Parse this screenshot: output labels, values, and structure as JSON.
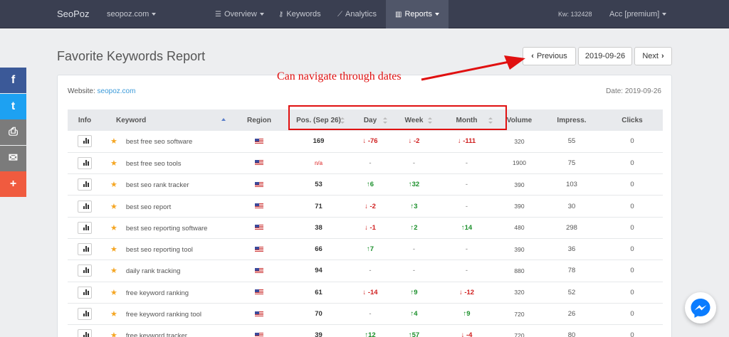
{
  "nav": {
    "brand": "SeoPoz",
    "site": "seopoz.com",
    "overview": "Overview",
    "keywords": "Keywords",
    "analytics": "Analytics",
    "reports": "Reports",
    "kw": "Kw: 132428",
    "acc": "Acc [premium]"
  },
  "page": {
    "title": "Favorite Keywords Report",
    "previous": "Previous",
    "date_btn": "2019-09-26",
    "next": "Next",
    "website_label": "Website:",
    "website": "seopoz.com",
    "date": "Date: 2019-09-26"
  },
  "annotation": {
    "text": "Can navigate through dates",
    "color": "#e01010"
  },
  "table": {
    "headers": [
      "Info",
      "Keyword",
      "Region",
      "Pos. (Sep 26)",
      "Day",
      "Week",
      "Month",
      "Volume",
      "Impress.",
      "Clicks"
    ],
    "rows": [
      {
        "keyword": "best free seo software",
        "pos": "169",
        "day": {
          "t": "-76",
          "d": "down"
        },
        "week": {
          "t": "-2",
          "d": "down"
        },
        "month": {
          "t": "-111",
          "d": "down"
        },
        "volume": "320",
        "impress": "55",
        "clicks": "0"
      },
      {
        "keyword": "best free seo tools",
        "pos": "n/a",
        "day": {
          "t": "-",
          "d": ""
        },
        "week": {
          "t": "-",
          "d": ""
        },
        "month": {
          "t": "-",
          "d": ""
        },
        "volume": "1900",
        "impress": "75",
        "clicks": "0"
      },
      {
        "keyword": "best seo rank tracker",
        "pos": "53",
        "day": {
          "t": "6",
          "d": "up"
        },
        "week": {
          "t": "32",
          "d": "up"
        },
        "month": {
          "t": "-",
          "d": ""
        },
        "volume": "390",
        "impress": "103",
        "clicks": "0"
      },
      {
        "keyword": "best seo report",
        "pos": "71",
        "day": {
          "t": "-2",
          "d": "down"
        },
        "week": {
          "t": "3",
          "d": "up"
        },
        "month": {
          "t": "-",
          "d": ""
        },
        "volume": "390",
        "impress": "30",
        "clicks": "0"
      },
      {
        "keyword": "best seo reporting software",
        "pos": "38",
        "day": {
          "t": "-1",
          "d": "down"
        },
        "week": {
          "t": "2",
          "d": "up"
        },
        "month": {
          "t": "14",
          "d": "up"
        },
        "volume": "480",
        "impress": "298",
        "clicks": "0"
      },
      {
        "keyword": "best seo reporting tool",
        "pos": "66",
        "day": {
          "t": "7",
          "d": "up"
        },
        "week": {
          "t": "-",
          "d": ""
        },
        "month": {
          "t": "-",
          "d": ""
        },
        "volume": "390",
        "impress": "36",
        "clicks": "0"
      },
      {
        "keyword": "daily rank tracking",
        "pos": "94",
        "day": {
          "t": "-",
          "d": ""
        },
        "week": {
          "t": "-",
          "d": ""
        },
        "month": {
          "t": "-",
          "d": ""
        },
        "volume": "880",
        "impress": "78",
        "clicks": "0"
      },
      {
        "keyword": "free keyword ranking",
        "pos": "61",
        "day": {
          "t": "-14",
          "d": "down"
        },
        "week": {
          "t": "9",
          "d": "up"
        },
        "month": {
          "t": "-12",
          "d": "down"
        },
        "volume": "320",
        "impress": "52",
        "clicks": "0"
      },
      {
        "keyword": "free keyword ranking tool",
        "pos": "70",
        "day": {
          "t": "-",
          "d": ""
        },
        "week": {
          "t": "4",
          "d": "up"
        },
        "month": {
          "t": "9",
          "d": "up"
        },
        "volume": "720",
        "impress": "26",
        "clicks": "0"
      },
      {
        "keyword": "free keyword tracker",
        "pos": "39",
        "day": {
          "t": "12",
          "d": "up"
        },
        "week": {
          "t": "57",
          "d": "up"
        },
        "month": {
          "t": "-4",
          "d": "down"
        },
        "volume": "720",
        "impress": "80",
        "clicks": "0"
      }
    ]
  },
  "social": [
    {
      "icon": "facebook-icon",
      "glyph": "f",
      "color": "#3b5998"
    },
    {
      "icon": "twitter-icon",
      "glyph": "t",
      "color": "#1da1f2"
    },
    {
      "icon": "print-icon",
      "glyph": "⎙",
      "color": "#7b7b7b"
    },
    {
      "icon": "email-icon",
      "glyph": "✉",
      "color": "#7b7b7b"
    },
    {
      "icon": "share-plus-icon",
      "glyph": "+",
      "color": "#f05b3f"
    }
  ],
  "colors": {
    "nav": "#3a3f51",
    "up": "#1a8f2a",
    "down": "#d02020",
    "link": "#3b9ad9"
  }
}
